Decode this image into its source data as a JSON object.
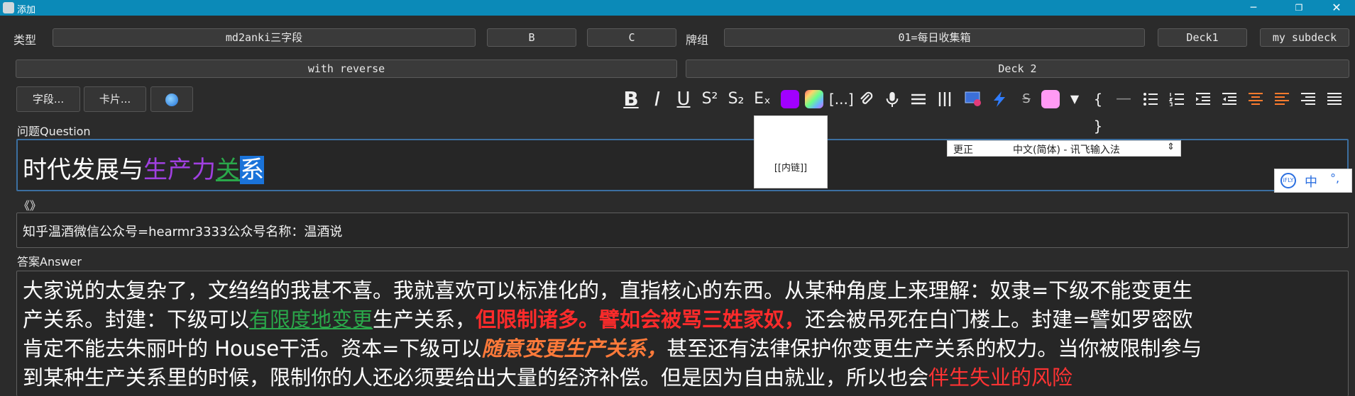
{
  "window": {
    "title": "添加",
    "min_icon": "minimize-icon",
    "max_icon": "restore-icon",
    "close_icon": "close-icon",
    "min_glyph": "─",
    "max_glyph": "❐",
    "close_glyph": "✕"
  },
  "note_type": {
    "label": "类型",
    "value": "md2anki三字段",
    "opt_b": "B",
    "opt_c": "C"
  },
  "deck": {
    "label": "牌组",
    "value": "01=每日收集箱",
    "opt1": "Deck1",
    "opt2": "my subdeck"
  },
  "row2": {
    "left": "with reverse",
    "right": "Deck 2"
  },
  "actions": {
    "fields": "字段...",
    "cards": "卡片...",
    "globe_icon": "globe-icon"
  },
  "toolbar": {
    "bold": "B",
    "italic": "I",
    "underline": "U",
    "superscript": "S²",
    "subscript": "S₂",
    "clear_format": "Eₓ",
    "cloze": "[...]",
    "more": "▼",
    "braces": "{ }",
    "hr": "—",
    "colors": {
      "text_color": "#a100ff",
      "highlight": "#ff9af4"
    }
  },
  "fields": {
    "question": {
      "label": "问题Question",
      "text_plain": "时代发展与",
      "text_purple": "生产力",
      "text_green": "关",
      "text_selected": "系"
    },
    "aside": {
      "label": "《》",
      "text": "知乎温酒微信公众号=hearmr3333公众号名称：温酒说"
    },
    "answer": {
      "label": "答案Answer",
      "l1": "大家说的太复杂了，文绉绉的我甚不喜。我就喜欢可以标准化的，直指核心的东西。从某种角度上来理解：奴隶=下级不能变更生",
      "l2a": "产关系。封建：下级可以",
      "l2b": "有限度地变更",
      "l2c": "生产关系，",
      "l2d": "但限制诸多。譬如会被骂三姓家奴，",
      "l2e": "还会被吊死在白门楼上。封建=譬如罗密欧",
      "l3a": "肯定不能去朱丽叶的 House干活。资本=下级可以",
      "l3b": "随意变更生产关系，",
      "l3c": "甚至还有法律保护你变更生产关系的权力。当你被限制参与",
      "l4a": "到某种生产关系里的时候，限制你的人还必须要给出大量的经济补偿。但是因为自由就业，所以也会",
      "l4b": "伴生失业的风险"
    }
  },
  "popup": {
    "text": "[[内链]]"
  },
  "ime": {
    "correct": "更正",
    "name": "中文(简体) - 讯飞输入法",
    "arrows": "⇕",
    "float_logo": "iFLY",
    "float_zh": "中",
    "float_punct": "°,"
  }
}
